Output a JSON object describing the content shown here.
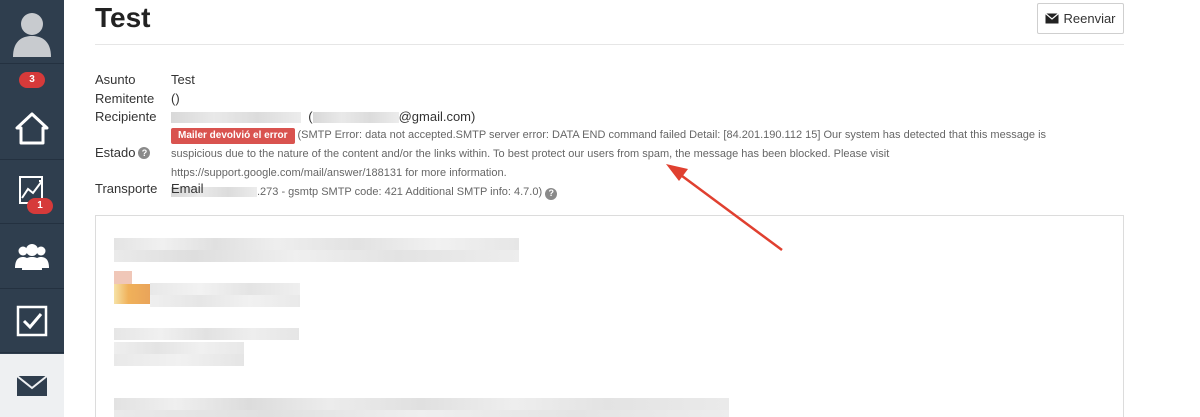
{
  "sidebar": {
    "items": [
      {
        "icon": "user-icon"
      },
      {
        "icon": "home-icon",
        "badge": "3"
      },
      {
        "icon": "chart-icon",
        "badge": "1"
      },
      {
        "icon": "group-icon"
      },
      {
        "icon": "checkbox-icon"
      },
      {
        "icon": "envelope-icon"
      }
    ]
  },
  "header": {
    "title": "Test",
    "resend_label": "Reenviar"
  },
  "details": {
    "subject_label": "Asunto",
    "subject_value": "Test",
    "sender_label": "Remitente",
    "sender_value": "()",
    "recipient_label": "Recipiente",
    "recipient_suffix": "@gmail.com)",
    "status_label": "Estado",
    "status_chip": "Mailer devolvió el error",
    "status_message": "(SMTP Error: data not accepted.SMTP server error: DATA END command failed Detail: [84.201.190.112 15] Our system has detected that this message is suspicious due to the nature of the content and/or the links within. To best protect our users from spam, the message has been blocked. Please visit https://support.google.com/mail/answer/188131 for more information.",
    "status_tail": ".273 - gsmtp SMTP code: 421 Additional SMTP info: 4.7.0)",
    "transport_label": "Transporte",
    "transport_value": "Email"
  },
  "colors": {
    "sidebar_bg": "#2f3e4e",
    "badge_red": "#d63a3a",
    "error_chip": "#d9534f",
    "arrow": "#e04030"
  }
}
